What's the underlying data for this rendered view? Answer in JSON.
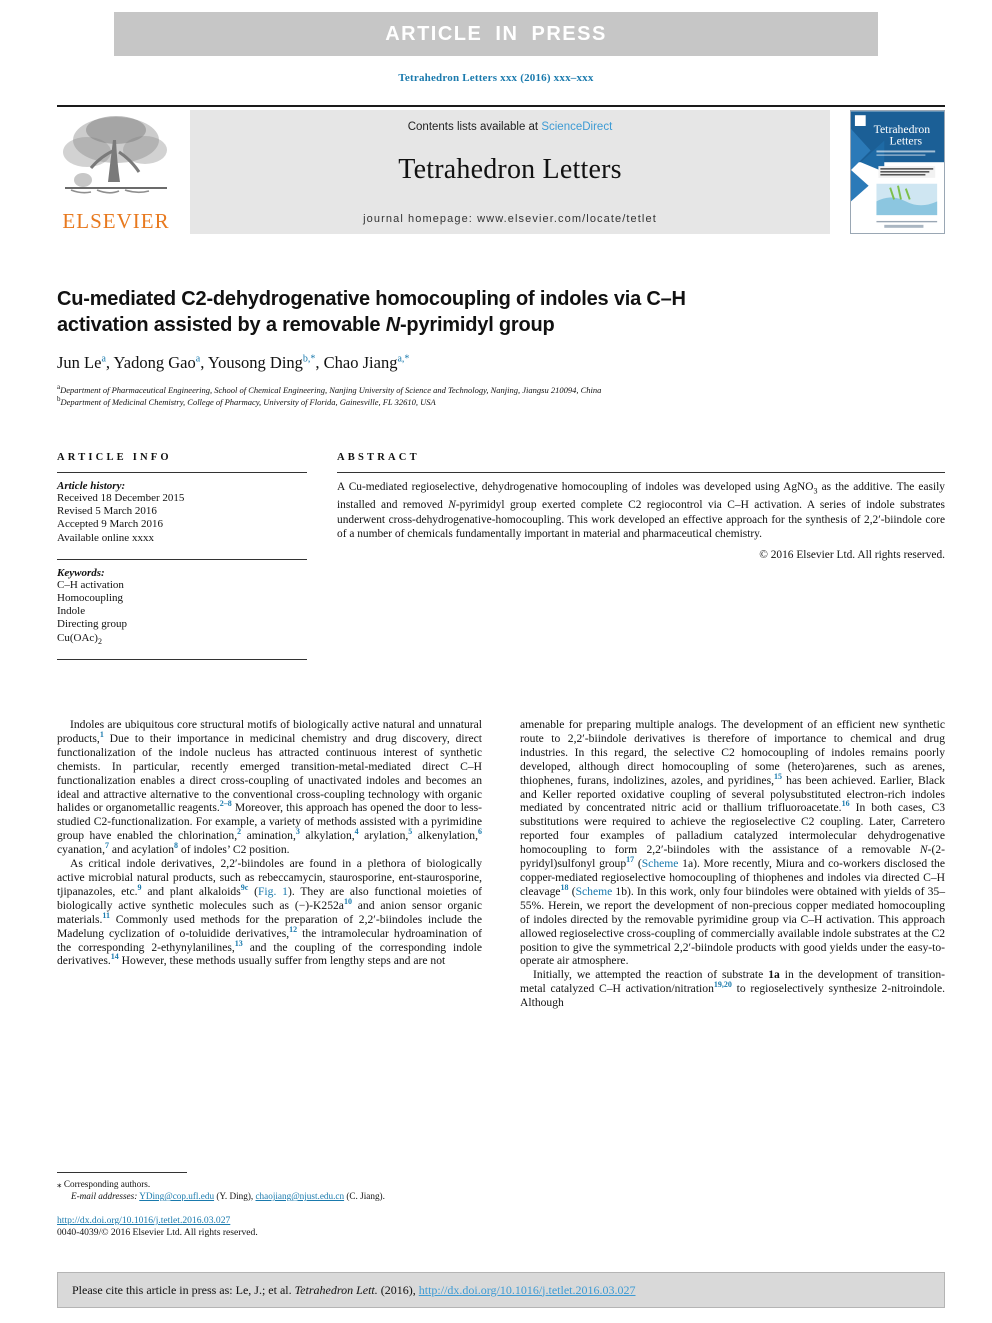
{
  "banner": {
    "text": "ARTICLE IN PRESS"
  },
  "journal_ref": "Tetrahedron Letters xxx (2016) xxx–xxx",
  "masthead": {
    "contents_prefix": "Contents lists available at ",
    "sciencedirect": "ScienceDirect",
    "journal_title": "Tetrahedron Letters",
    "homepage": "journal homepage: www.elsevier.com/locate/tetlet",
    "publisher_wordmark": "ELSEVIER",
    "cover_title_line1": "Tetrahedron",
    "cover_title_line2": "Letters"
  },
  "article": {
    "title_line1": "Cu-mediated C2-dehydrogenative homocoupling of indoles via C–H",
    "title_line2_a": "activation assisted by a removable ",
    "title_line2_italic": "N",
    "title_line2_b": "-pyrimidyl group",
    "authors": [
      {
        "name": "Jun Le",
        "marks": "a"
      },
      {
        "name": "Yadong Gao",
        "marks": "a"
      },
      {
        "name": "Yousong Ding",
        "marks": "b,*"
      },
      {
        "name": "Chao Jiang",
        "marks": "a,*"
      }
    ],
    "affiliations": [
      {
        "label": "a",
        "text": "Department of Pharmaceutical Engineering, School of Chemical Engineering, Nanjing University of Science and Technology, Nanjing, Jiangsu 210094, China"
      },
      {
        "label": "b",
        "text": "Department of Medicinal Chemistry, College of Pharmacy, University of Florida, Gainesville, FL 32610, USA"
      }
    ]
  },
  "info": {
    "heading": "ARTICLE INFO",
    "history_label": "Article history:",
    "history": [
      "Received 18 December 2015",
      "Revised 5 March 2016",
      "Accepted 9 March 2016",
      "Available online xxxx"
    ],
    "keywords_label": "Keywords:",
    "keywords": [
      "C–H activation",
      "Homocoupling",
      "Indole",
      "Directing group",
      "Cu(OAc)2"
    ]
  },
  "abstract": {
    "heading": "ABSTRACT",
    "part1": "A Cu-mediated regioselective, dehydrogenative homocoupling of indoles was developed using AgNO",
    "sub1": "3",
    "part2": " as the additive. The easily installed and removed ",
    "italic1": "N",
    "part3": "-pyrimidyl group exerted complete C2 regiocontrol via C–H activation. A series of indole substrates underwent cross-dehydrogenative-homocoupling. This work developed an effective approach for the synthesis of 2,2′-biindole core of a number of chemicals fundamentally important in material and pharmaceutical chemistry.",
    "copyright": "© 2016 Elsevier Ltd. All rights reserved."
  },
  "body": {
    "left": [
      {
        "segments": [
          {
            "t": "Indoles are ubiquitous core structural motifs of biologically active natural and unnatural products,"
          },
          {
            "t": "1",
            "k": "sup"
          },
          {
            "t": " Due to their importance in medicinal chemistry and drug discovery, direct functionalization of the indole nucleus has attracted continuous interest of synthetic chemists. In particular, recently emerged transition-metal-mediated direct C–H functionalization enables a direct cross-coupling of unactivated indoles and becomes an ideal and attractive alternative to the conventional cross-coupling technology with organic halides or organometallic reagents."
          },
          {
            "t": "2–8",
            "k": "sup"
          },
          {
            "t": " Moreover, this approach has opened the door to less-studied C2-functionalization. For example, a variety of methods assisted with a pyrimidine group have enabled the chlorination,"
          },
          {
            "t": "2",
            "k": "sup"
          },
          {
            "t": " amination,"
          },
          {
            "t": "3",
            "k": "sup"
          },
          {
            "t": " alkylation,"
          },
          {
            "t": "4",
            "k": "sup"
          },
          {
            "t": " arylation,"
          },
          {
            "t": "5",
            "k": "sup"
          },
          {
            "t": " alkenylation,"
          },
          {
            "t": "6",
            "k": "sup"
          },
          {
            "t": " cyanation,"
          },
          {
            "t": "7",
            "k": "sup"
          },
          {
            "t": " and acylation"
          },
          {
            "t": "8",
            "k": "sup"
          },
          {
            "t": " of indoles’ C2 position."
          }
        ]
      },
      {
        "segments": [
          {
            "t": "As critical indole derivatives, 2,2′-biindoles are found in a plethora of biologically active microbial natural products, such as rebeccamycin, staurosporine, ent-staurosporine, tjipanazoles, etc."
          },
          {
            "t": "9",
            "k": "sup"
          },
          {
            "t": " and plant alkaloids"
          },
          {
            "t": "9c",
            "k": "sup"
          },
          {
            "t": " ("
          },
          {
            "t": "Fig. 1",
            "k": "lnk"
          },
          {
            "t": "). They are also functional moieties of biologically active synthetic molecules such as (−)-K252a"
          },
          {
            "t": "10",
            "k": "sup"
          },
          {
            "t": " and anion sensor organic materials."
          },
          {
            "t": "11",
            "k": "sup"
          },
          {
            "t": " Commonly used methods for the preparation of 2,2′-biindoles include the Madelung cyclization of o-toluidide derivatives,"
          },
          {
            "t": "12",
            "k": "sup"
          },
          {
            "t": " the intramolecular hydroamination of the corresponding 2-ethynylanilines,"
          },
          {
            "t": "13",
            "k": "sup"
          },
          {
            "t": " and the coupling of the corresponding indole derivatives."
          },
          {
            "t": "14",
            "k": "sup"
          },
          {
            "t": " However, these methods usually suffer from lengthy steps and are not"
          }
        ]
      }
    ],
    "right": [
      {
        "noindent": true,
        "segments": [
          {
            "t": "amenable for preparing multiple analogs. The development of an efficient new synthetic route to 2,2′-biindole derivatives is therefore of importance to chemical and drug industries. In this regard, the selective C2 homocoupling of indoles remains poorly developed, although direct homocoupling of some (hetero)arenes, such as arenes, thiophenes, furans, indolizines, azoles, and pyridines,"
          },
          {
            "t": "15",
            "k": "sup"
          },
          {
            "t": " has been achieved. Earlier, Black and Keller reported oxidative coupling of several polysubstituted electron-rich indoles mediated by concentrated nitric acid or thallium trifluoroacetate."
          },
          {
            "t": "16",
            "k": "sup"
          },
          {
            "t": " In both cases, C3 substitutions were required to achieve the regioselective C2 coupling. Later, Carretero reported four examples of palladium catalyzed intermolecular dehydrogenative homocoupling to form 2,2′-biindoles with the assistance of a removable "
          },
          {
            "t": "N",
            "k": "it"
          },
          {
            "t": "-(2-pyridyl)sulfonyl group"
          },
          {
            "t": "17",
            "k": "sup"
          },
          {
            "t": " ("
          },
          {
            "t": "Scheme",
            "k": "lnk"
          },
          {
            "t": " 1a). More recently, Miura and co-workers disclosed the copper-mediated regioselective homocoupling of thiophenes and indoles via directed C–H cleavage"
          },
          {
            "t": "18",
            "k": "sup"
          },
          {
            "t": " ("
          },
          {
            "t": "Scheme",
            "k": "lnk"
          },
          {
            "t": " 1b). In this work, only four biindoles were obtained with yields of 35–55%. Herein, we report the development of non-precious copper mediated homocoupling of indoles directed by the removable pyrimidine group via C–H activation. This approach allowed regioselective cross-coupling of commercially available indole substrates at the C2 position to give the symmetrical 2,2′-biindole products with good yields under the easy-to-operate air atmosphere."
          }
        ]
      },
      {
        "segments": [
          {
            "t": "Initially, we attempted the reaction of substrate "
          },
          {
            "t": "1a",
            "k": "bd"
          },
          {
            "t": " in the development of transition-metal catalyzed C–H activation/nitration"
          },
          {
            "t": "19,20",
            "k": "sup"
          },
          {
            "t": " to regioselectively synthesize 2-nitroindole. Although"
          }
        ]
      }
    ]
  },
  "footnote": {
    "corresponding": "Corresponding authors.",
    "email_label": "E-mail addresses:",
    "email1": "YDing@cop.ufl.edu",
    "email1_who": " (Y. Ding),",
    "email2": "chaojiang@njust.edu.cn",
    "email2_who": " (C. Jiang).",
    "doi": "http://dx.doi.org/10.1016/j.tetlet.2016.03.027",
    "issn": "0040-4039/© 2016 Elsevier Ltd. All rights reserved."
  },
  "cite": {
    "prefix": "Please cite this article in press as: Le, J.; et al. ",
    "journal_italic": "Tetrahedron Lett.",
    "middle": " (2016), ",
    "link": "http://dx.doi.org/10.1016/j.tetlet.2016.03.027"
  },
  "colors": {
    "link": "#1a7aad",
    "banner_bg": "#c6c6c6",
    "mast_bg": "#e6e6e6",
    "elsevier_orange": "#e8791e",
    "cite_bg": "#d9d9d9"
  }
}
